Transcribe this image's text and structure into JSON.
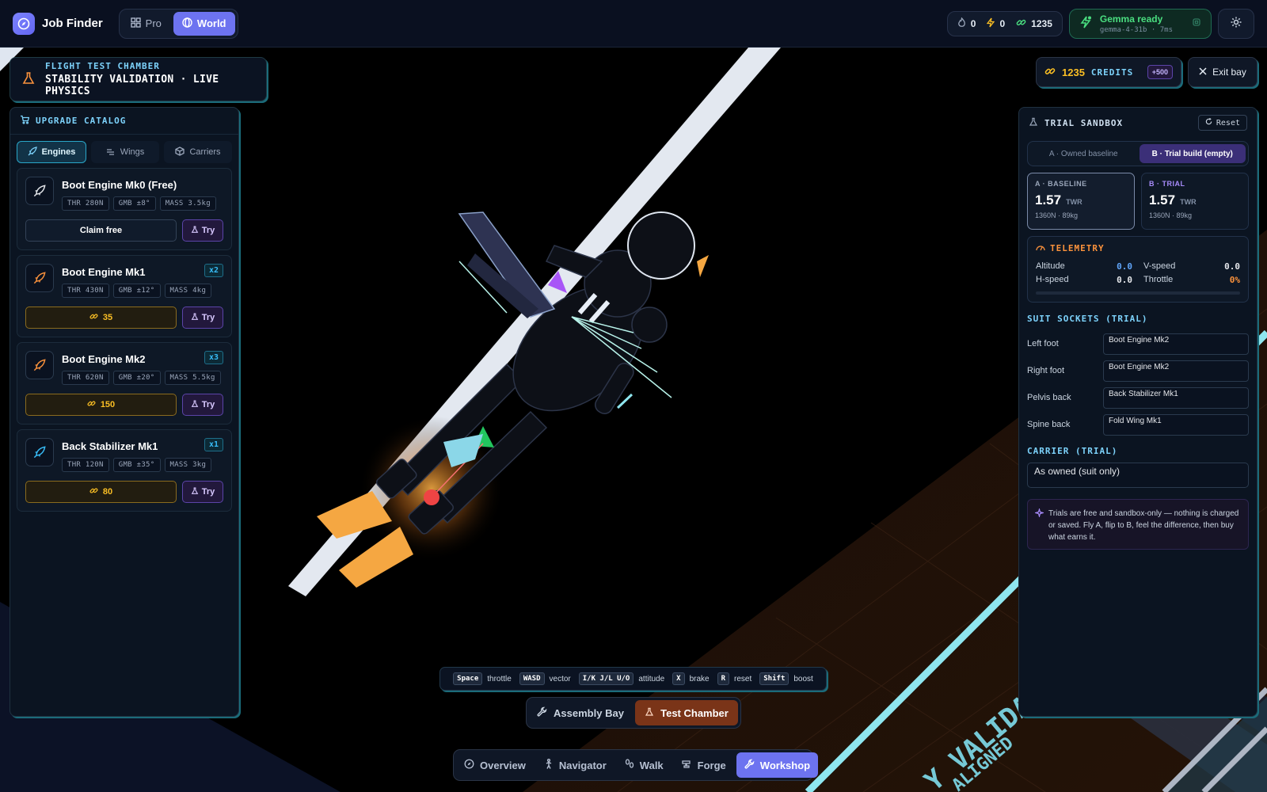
{
  "app": {
    "title": "Job Finder",
    "modes": [
      {
        "label": "Pro",
        "icon": "grid-icon",
        "active": false
      },
      {
        "label": "World",
        "icon": "globe-icon",
        "active": true
      }
    ]
  },
  "stats": {
    "streak": "0",
    "energy": "0",
    "credits": "1235"
  },
  "ai_status": {
    "title": "Gemma ready",
    "subtitle": "gemma-4-31b · 7ms"
  },
  "chamber": {
    "kicker": "FLIGHT TEST CHAMBER",
    "title": "STABILITY VALIDATION · LIVE PHYSICS"
  },
  "catalog": {
    "title": "UPGRADE CATALOG",
    "tabs": [
      {
        "label": "Engines",
        "icon": "rocket-icon",
        "active": true
      },
      {
        "label": "Wings",
        "icon": "wings-icon",
        "active": false
      },
      {
        "label": "Carriers",
        "icon": "box-icon",
        "active": false
      }
    ],
    "items": [
      {
        "name": "Boot Engine Mk0 (Free)",
        "badge": "",
        "chips": [
          "THR 280N",
          "GMB ±8°",
          "MASS 3.5kg"
        ],
        "action": "Claim free",
        "try": "Try",
        "icon_color": "#e5e7eb"
      },
      {
        "name": "Boot Engine Mk1",
        "badge": "x2",
        "chips": [
          "THR 430N",
          "GMB ±12°",
          "MASS 4kg"
        ],
        "action": "35",
        "try": "Try",
        "icon_color": "#fb923c"
      },
      {
        "name": "Boot Engine Mk2",
        "badge": "x3",
        "chips": [
          "THR 620N",
          "GMB ±20°",
          "MASS 5.5kg"
        ],
        "action": "150",
        "try": "Try",
        "icon_color": "#fb923c"
      },
      {
        "name": "Back Stabilizer Mk1",
        "badge": "x1",
        "chips": [
          "THR 120N",
          "GMB ±35°",
          "MASS 3kg"
        ],
        "action": "80",
        "try": "Try",
        "icon_color": "#38bdf8"
      }
    ]
  },
  "credits_panel": {
    "value": "1235",
    "label": "CREDITS",
    "plus": "+500"
  },
  "exit_label": "Exit bay",
  "sandbox": {
    "title": "TRIAL SANDBOX",
    "reset": "Reset",
    "toggle": [
      "A · Owned baseline",
      "B · Trial build (empty)"
    ],
    "baseline": {
      "kicker": "A · BASELINE",
      "twr": "1.57",
      "unit": "TWR",
      "meta": "1360N · 89kg"
    },
    "trial": {
      "kicker": "B · TRIAL",
      "twr": "1.57",
      "unit": "TWR",
      "meta": "1360N · 89kg"
    },
    "telemetry": {
      "title": "TELEMETRY",
      "altitude_label": "Altitude",
      "altitude": "0.0",
      "vspeed_label": "V-speed",
      "vspeed": "0.0",
      "hspeed_label": "H-speed",
      "hspeed": "0.0",
      "throttle_label": "Throttle",
      "throttle": "0%",
      "throttle_fraction": 0
    },
    "sockets_title": "SUIT SOCKETS (TRIAL)",
    "sockets": [
      {
        "label": "Left foot",
        "value": "Boot Engine Mk2"
      },
      {
        "label": "Right foot",
        "value": "Boot Engine Mk2"
      },
      {
        "label": "Pelvis back",
        "value": "Back Stabilizer Mk1"
      },
      {
        "label": "Spine back",
        "value": "Fold Wing Mk1"
      }
    ],
    "carrier_title": "CARRIER (TRIAL)",
    "carrier_value": "As owned (suit only)",
    "note": "Trials are free and sandbox-only — nothing is charged or saved. Fly A, flip to B, feel the difference, then buy what earns it."
  },
  "keyhints": [
    {
      "key": "Space",
      "action": "throttle"
    },
    {
      "key": "WASD",
      "action": "vector"
    },
    {
      "key": "I/K J/L U/O",
      "action": "attitude"
    },
    {
      "key": "X",
      "action": "brake"
    },
    {
      "key": "R",
      "action": "reset"
    },
    {
      "key": "Shift",
      "action": "boost"
    }
  ],
  "bay_switch": [
    {
      "label": "Assembly Bay",
      "active": false
    },
    {
      "label": "Test Chamber",
      "active": true
    }
  ],
  "nav": [
    {
      "label": "Overview",
      "active": false
    },
    {
      "label": "Navigator",
      "active": false
    },
    {
      "label": "Walk",
      "active": false
    },
    {
      "label": "Forge",
      "active": false
    },
    {
      "label": "Workshop",
      "active": true
    }
  ],
  "floor_text": [
    "Y VALIDATION",
    "ALIGNED"
  ],
  "colors": {
    "accent": "#6d73f0",
    "cyan": "#7dd3fc",
    "gold": "#fbbf24",
    "orange": "#fb923c",
    "green": "#4ade80",
    "flame": "#f5a742"
  }
}
